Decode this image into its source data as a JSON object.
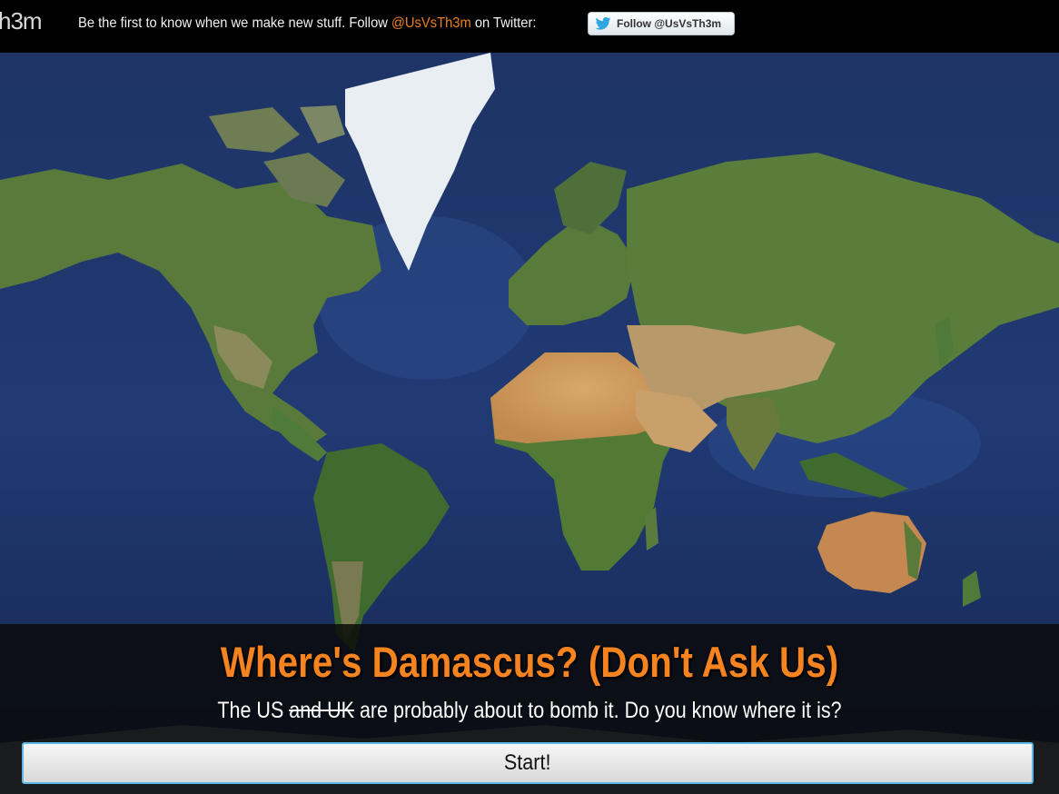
{
  "header": {
    "logo_text": "h3m",
    "promo_prefix": "Be the first to know when we make new stuff. Follow ",
    "promo_handle": "@UsVsTh3m",
    "promo_suffix": " on Twitter:",
    "follow_button_label": "Follow @UsVsTh3m",
    "follow_icon": "twitter-bird-icon",
    "accent_color": "#f0801c"
  },
  "map": {
    "description_icon": "world-satellite-map"
  },
  "quiz": {
    "title": "Where's Damascus? (Don't Ask Us)",
    "subtitle_prefix": "The US ",
    "subtitle_struck": "and UK",
    "subtitle_suffix": " are probably about to bomb it. Do you know where it is?",
    "start_label": "Start!",
    "title_color": "#f48320"
  }
}
